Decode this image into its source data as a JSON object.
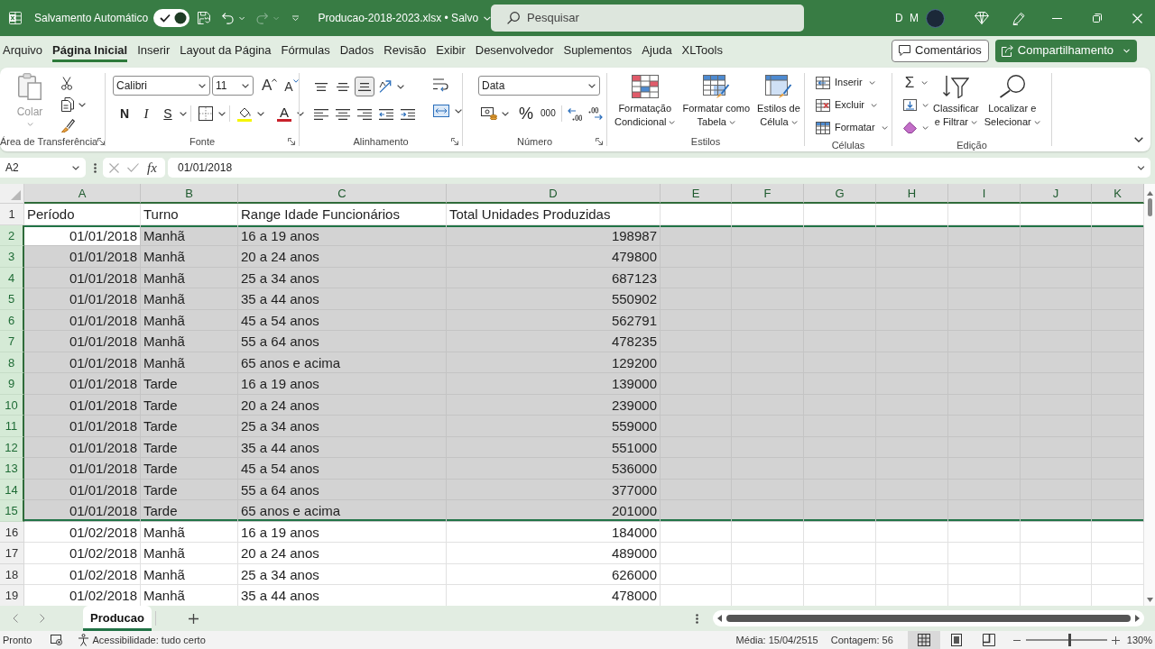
{
  "title_bar": {
    "autosave_label": "Salvamento Automático",
    "autosave_on": true,
    "redo": {
      "disabled": true
    },
    "file_name": "Producao-2018-2023.xlsx • Salvo",
    "search": {
      "placeholder": "Pesquisar"
    },
    "user_initials": "D M"
  },
  "menu_tabs": [
    {
      "label": "Arquivo",
      "selected": false
    },
    {
      "label": "Página Inicial",
      "selected": true
    },
    {
      "label": "Inserir",
      "selected": false
    },
    {
      "label": "Layout da Página",
      "selected": false
    },
    {
      "label": "Fórmulas",
      "selected": false
    },
    {
      "label": "Dados",
      "selected": false
    },
    {
      "label": "Revisão",
      "selected": false
    },
    {
      "label": "Exibir",
      "selected": false
    },
    {
      "label": "Desenvolvedor",
      "selected": false
    },
    {
      "label": "Suplementos",
      "selected": false
    },
    {
      "label": "Ajuda",
      "selected": false
    },
    {
      "label": "XLTools",
      "selected": false
    }
  ],
  "comments_button": "Comentários",
  "share_button": "Compartilhamento",
  "ribbon": {
    "clipboard": {
      "label": "Área de Transferência",
      "paste": {
        "label": "Colar",
        "disabled": true
      }
    },
    "font": {
      "label": "Fonte",
      "font_name": "Calibri",
      "font_size": "11",
      "grow_glyph": "A",
      "shrink_glyph": "A",
      "style_buttons": [
        {
          "kind": "bold",
          "label": "N"
        },
        {
          "kind": "italic",
          "label": "I"
        },
        {
          "kind": "underline",
          "label": "S"
        }
      ],
      "font_color_glyph": "A"
    },
    "alignment": {
      "label": "Alinhamento",
      "vertical_align": [
        {
          "kind": "top",
          "selected": false
        },
        {
          "kind": "middle",
          "selected": false
        },
        {
          "kind": "bottom",
          "selected": true
        }
      ]
    },
    "number": {
      "label": "Número",
      "format": "Data",
      "percent": "%",
      "thousands": "000"
    },
    "styles": {
      "label": "Estilos",
      "buttons": [
        {
          "kind": "conditional",
          "lines": [
            "Formatação",
            "Condicional"
          ]
        },
        {
          "kind": "table",
          "lines": [
            "Formatar como",
            "Tabela"
          ]
        },
        {
          "kind": "cell_styles",
          "lines": [
            "Estilos de",
            "Célula"
          ]
        }
      ]
    },
    "cells": {
      "label": "Células",
      "buttons": [
        {
          "kind": "insert",
          "label": "Inserir"
        },
        {
          "kind": "delete",
          "label": "Excluir"
        },
        {
          "kind": "format",
          "label": "Formatar"
        }
      ]
    },
    "editing": {
      "label": "Edição",
      "autosum": "Σ",
      "buttons": [
        {
          "kind": "sort_filter",
          "lines": [
            "Classificar",
            "e Filtrar"
          ]
        },
        {
          "kind": "find",
          "lines": [
            "Localizar e",
            "Selecionar"
          ]
        }
      ]
    }
  },
  "formula_bar": {
    "name_box": "A2",
    "fx": "fx",
    "value": "01/01/2018"
  },
  "sheet": {
    "columns": [
      {
        "label": "A",
        "selected": true,
        "active": true
      },
      {
        "label": "B",
        "selected": true,
        "active": false
      },
      {
        "label": "C",
        "selected": true,
        "active": false
      },
      {
        "label": "D",
        "selected": true,
        "active": false
      },
      {
        "label": "E",
        "selected": true,
        "active": false
      },
      {
        "label": "F",
        "selected": true,
        "active": false
      },
      {
        "label": "G",
        "selected": true,
        "active": false
      },
      {
        "label": "H",
        "selected": true,
        "active": false
      },
      {
        "label": "I",
        "selected": true,
        "active": false
      },
      {
        "label": "J",
        "selected": true,
        "active": false
      },
      {
        "label": "K",
        "selected": true,
        "active": false
      }
    ],
    "rows": [
      {
        "number": "1",
        "selected": false,
        "active": false,
        "kind": "header",
        "cells": [
          "Período",
          "Turno",
          "Range Idade Funcionários",
          "Total Unidades Produzidas"
        ]
      },
      {
        "number": "2",
        "selected": true,
        "active": true,
        "kind": "data",
        "cells": [
          "01/01/2018",
          "Manhã",
          "16 a 19 anos",
          "198987"
        ]
      },
      {
        "number": "3",
        "selected": true,
        "active": false,
        "kind": "data",
        "cells": [
          "01/01/2018",
          "Manhã",
          "20 a 24 anos",
          "479800"
        ]
      },
      {
        "number": "4",
        "selected": true,
        "active": false,
        "kind": "data",
        "cells": [
          "01/01/2018",
          "Manhã",
          "25 a 34 anos",
          "687123"
        ]
      },
      {
        "number": "5",
        "selected": true,
        "active": false,
        "kind": "data",
        "cells": [
          "01/01/2018",
          "Manhã",
          "35 a 44 anos",
          "550902"
        ]
      },
      {
        "number": "6",
        "selected": true,
        "active": false,
        "kind": "data",
        "cells": [
          "01/01/2018",
          "Manhã",
          "45 a 54 anos",
          "562791"
        ]
      },
      {
        "number": "7",
        "selected": true,
        "active": false,
        "kind": "data",
        "cells": [
          "01/01/2018",
          "Manhã",
          "55 a 64 anos",
          "478235"
        ]
      },
      {
        "number": "8",
        "selected": true,
        "active": false,
        "kind": "data",
        "cells": [
          "01/01/2018",
          "Manhã",
          "65 anos e acima",
          "129200"
        ]
      },
      {
        "number": "9",
        "selected": true,
        "active": false,
        "kind": "data",
        "cells": [
          "01/01/2018",
          "Tarde",
          "16 a 19 anos",
          "139000"
        ]
      },
      {
        "number": "10",
        "selected": true,
        "active": false,
        "kind": "data",
        "cells": [
          "01/01/2018",
          "Tarde",
          "20 a 24 anos",
          "239000"
        ]
      },
      {
        "number": "11",
        "selected": true,
        "active": false,
        "kind": "data",
        "cells": [
          "01/01/2018",
          "Tarde",
          "25 a 34 anos",
          "559000"
        ]
      },
      {
        "number": "12",
        "selected": true,
        "active": false,
        "kind": "data",
        "cells": [
          "01/01/2018",
          "Tarde",
          "35 a 44 anos",
          "551000"
        ]
      },
      {
        "number": "13",
        "selected": true,
        "active": false,
        "kind": "data",
        "cells": [
          "01/01/2018",
          "Tarde",
          "45 a 54 anos",
          "536000"
        ]
      },
      {
        "number": "14",
        "selected": true,
        "active": false,
        "kind": "data",
        "cells": [
          "01/01/2018",
          "Tarde",
          "55 a 64 anos",
          "377000"
        ]
      },
      {
        "number": "15",
        "selected": true,
        "active": false,
        "kind": "data",
        "cells": [
          "01/01/2018",
          "Tarde",
          "65 anos e acima",
          "201000"
        ]
      },
      {
        "number": "16",
        "selected": false,
        "active": false,
        "kind": "data",
        "cells": [
          "01/02/2018",
          "Manhã",
          "16 a 19 anos",
          "184000"
        ]
      },
      {
        "number": "17",
        "selected": false,
        "active": false,
        "kind": "data",
        "cells": [
          "01/02/2018",
          "Manhã",
          "20 a 24 anos",
          "489000"
        ]
      },
      {
        "number": "18",
        "selected": false,
        "active": false,
        "kind": "data",
        "cells": [
          "01/02/2018",
          "Manhã",
          "25 a 34 anos",
          "626000"
        ]
      },
      {
        "number": "19",
        "selected": false,
        "active": false,
        "kind": "data",
        "cells": [
          "01/02/2018",
          "Manhã",
          "35 a 44 anos",
          "478000"
        ]
      }
    ]
  },
  "sheet_tabs": [
    {
      "label": "Producao",
      "selected": true
    }
  ],
  "status_bar": {
    "mode": "Pronto",
    "accessibility": "Acessibilidade: tudo certo",
    "average": "Média: 15/04/2515",
    "count": "Contagem: 56",
    "views": [
      {
        "kind": "normal",
        "selected": true
      },
      {
        "kind": "page_layout",
        "selected": false
      },
      {
        "kind": "page_break",
        "selected": false
      }
    ],
    "zoom": {
      "level": 0.54,
      "reading": "130%"
    }
  }
}
